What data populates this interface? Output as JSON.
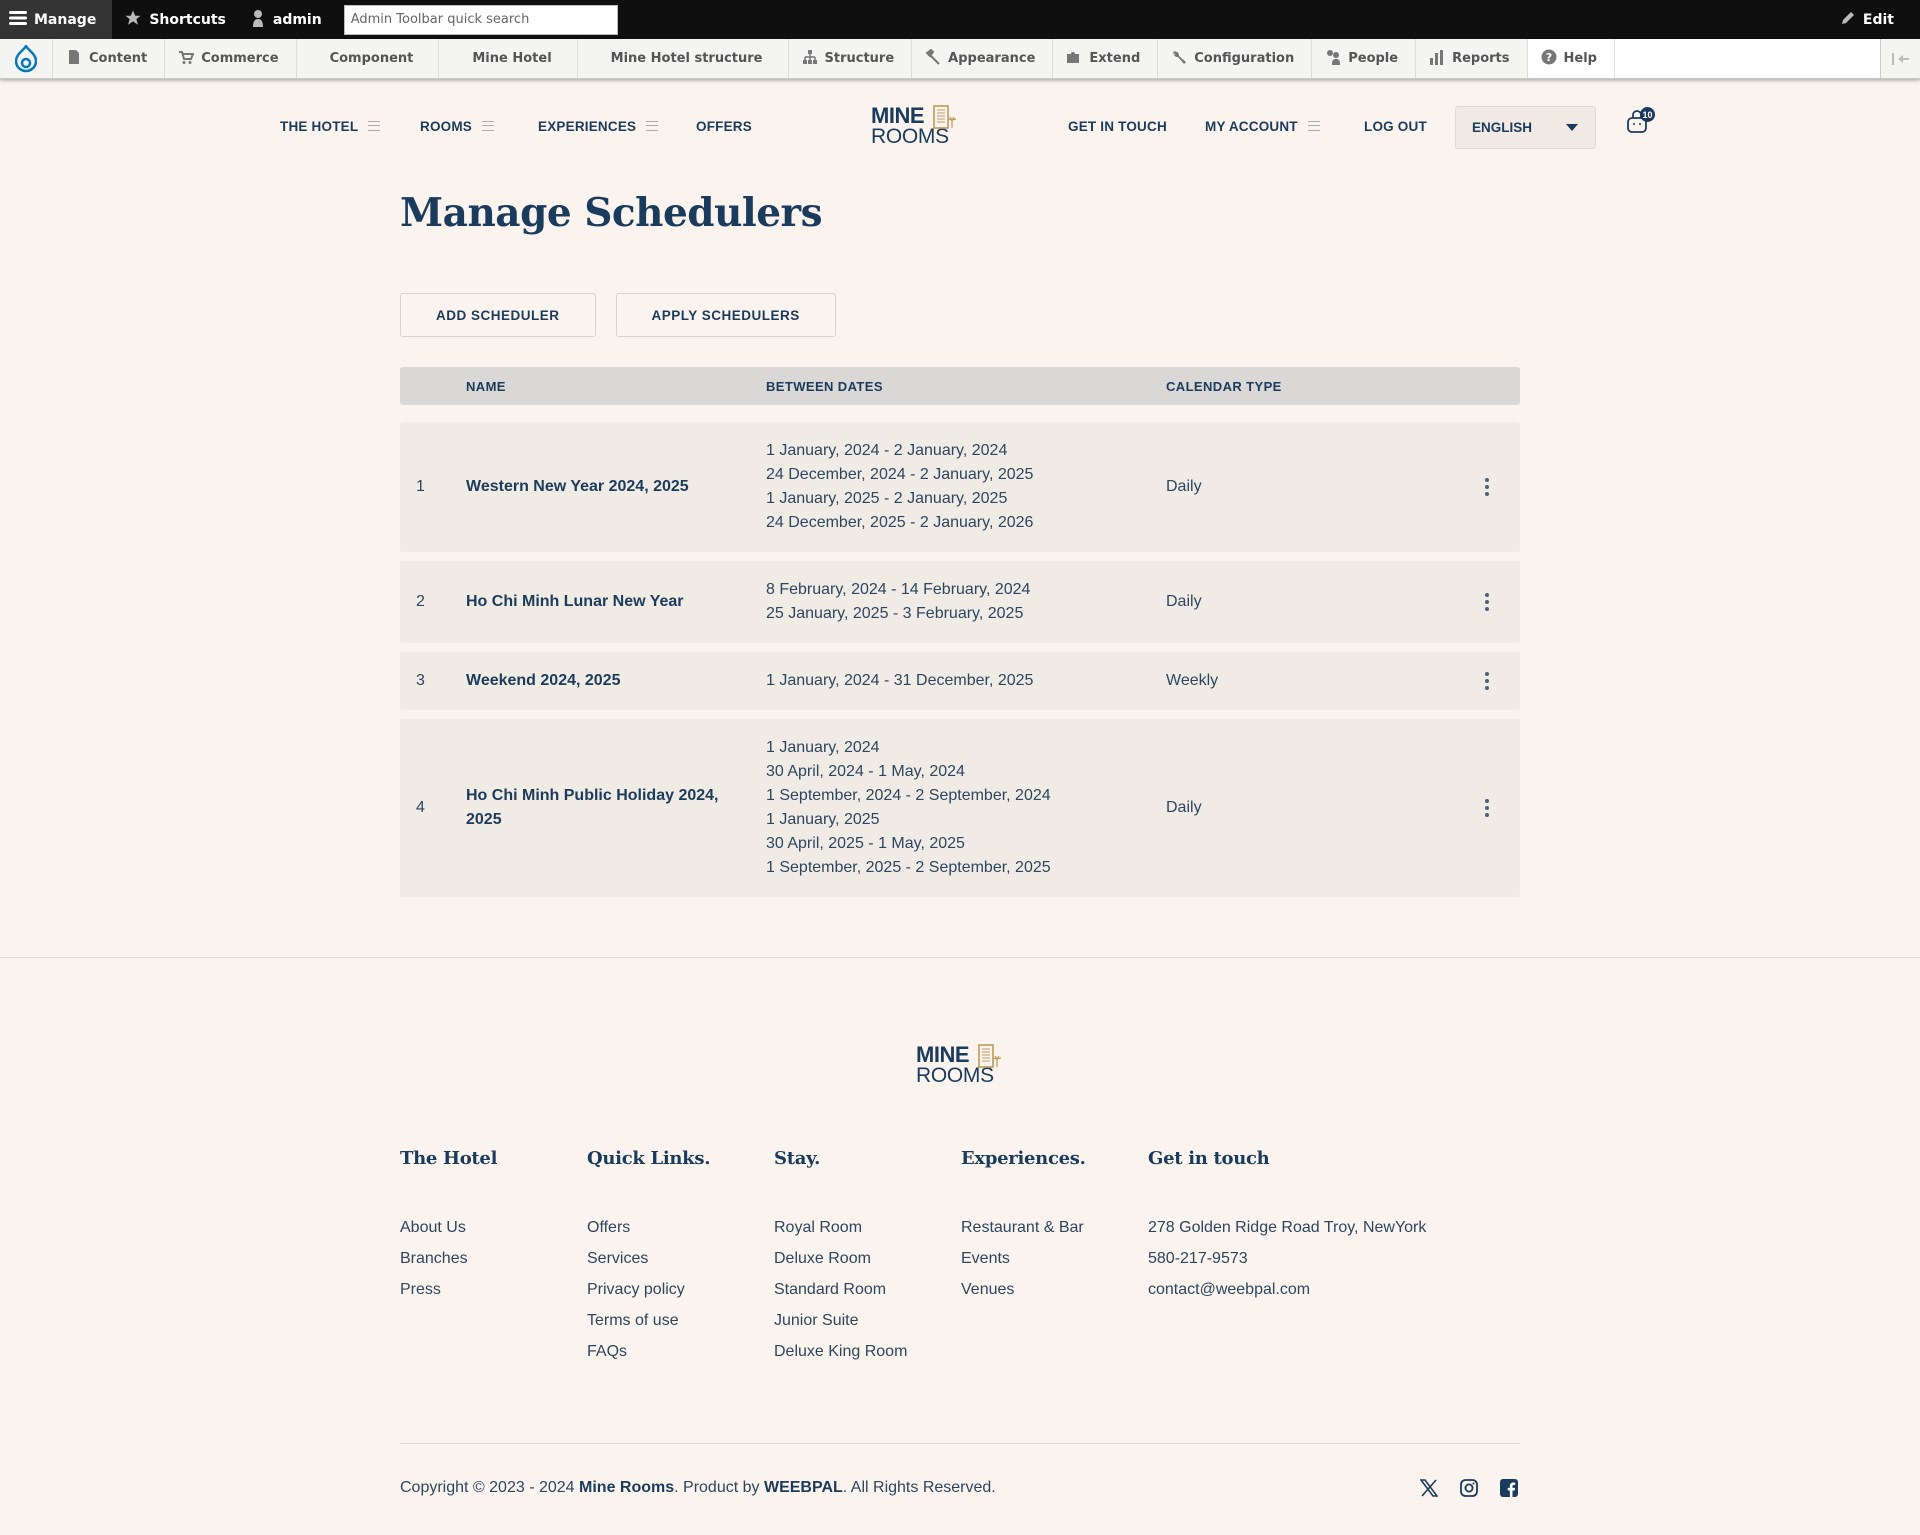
{
  "admin_toolbar": {
    "manage_label": "Manage",
    "shortcuts_label": "Shortcuts",
    "user_label": "admin",
    "search_placeholder": "Admin Toolbar quick search",
    "edit_label": "Edit",
    "menu": [
      {
        "label": "Content",
        "icon": "file-icon"
      },
      {
        "label": "Commerce",
        "icon": "cart-icon"
      },
      {
        "label": "Component",
        "icon": ""
      },
      {
        "label": "Mine Hotel",
        "icon": ""
      },
      {
        "label": "Mine Hotel structure",
        "icon": ""
      },
      {
        "label": "Structure",
        "icon": "sitemap-icon"
      },
      {
        "label": "Appearance",
        "icon": "paintbrush-icon"
      },
      {
        "label": "Extend",
        "icon": "puzzle-icon"
      },
      {
        "label": "Configuration",
        "icon": "wrench-icon"
      },
      {
        "label": "People",
        "icon": "people-icon"
      },
      {
        "label": "Reports",
        "icon": "bar-chart-icon"
      },
      {
        "label": "Help",
        "icon": "help-icon"
      }
    ]
  },
  "site_nav": {
    "left": [
      {
        "label": "THE HOTEL",
        "has_menu": true
      },
      {
        "label": "ROOMS",
        "has_menu": true
      },
      {
        "label": "EXPERIENCES",
        "has_menu": true
      },
      {
        "label": "OFFERS",
        "has_menu": false
      }
    ],
    "right": [
      {
        "label": "GET IN TOUCH",
        "has_menu": false
      },
      {
        "label": "MY ACCOUNT",
        "has_menu": true
      },
      {
        "label": "LOG OUT",
        "has_menu": false
      }
    ],
    "logo": {
      "line1": "MINE",
      "line2": "ROOMS"
    },
    "language": "ENGLISH",
    "cart_count": "10"
  },
  "page": {
    "title": "Manage Schedulers",
    "buttons": {
      "add": "ADD SCHEDULER",
      "apply": "APPLY SCHEDULERS"
    },
    "table": {
      "headers": {
        "num": "",
        "name": "NAME",
        "dates": "BETWEEN DATES",
        "type": "CALENDAR TYPE"
      },
      "rows": [
        {
          "num": "1",
          "name": "Western New Year 2024, 2025",
          "dates": [
            "1 January, 2024 - 2 January, 2024",
            "24 December, 2024 - 2 January, 2025",
            "1 January, 2025 - 2 January, 2025",
            "24 December, 2025 - 2 January, 2026"
          ],
          "type": "Daily"
        },
        {
          "num": "2",
          "name": "Ho Chi Minh Lunar New Year",
          "dates": [
            "8 February, 2024 - 14 February, 2024",
            "25 January, 2025 - 3 February, 2025"
          ],
          "type": "Daily"
        },
        {
          "num": "3",
          "name": "Weekend 2024, 2025",
          "dates": [
            "1 January, 2024 - 31 December, 2025"
          ],
          "type": "Weekly"
        },
        {
          "num": "4",
          "name": "Ho Chi Minh Public Holiday 2024, 2025",
          "dates": [
            "1 January, 2024",
            "30 April, 2024 - 1 May, 2024",
            "1 September, 2024 - 2 September, 2024",
            "1 January, 2025",
            "30 April, 2025 - 1 May, 2025",
            "1 September, 2025 - 2 September, 2025"
          ],
          "type": "Daily"
        }
      ]
    }
  },
  "footer": {
    "logo": {
      "line1": "MINE",
      "line2": "ROOMS"
    },
    "columns": [
      {
        "title": "The Hotel",
        "links": [
          "About Us",
          "Branches",
          "Press"
        ]
      },
      {
        "title": "Quick Links.",
        "links": [
          "Offers",
          "Services",
          "Privacy policy",
          "Terms of use",
          "FAQs"
        ]
      },
      {
        "title": "Stay.",
        "links": [
          "Royal Room",
          "Deluxe Room",
          "Standard Room",
          "Junior Suite",
          "Deluxe King Room"
        ]
      },
      {
        "title": "Experiences.",
        "links": [
          "Restaurant & Bar",
          "Events",
          "Venues"
        ]
      },
      {
        "title": "Get in touch",
        "links": [
          "278 Golden Ridge Road Troy, NewYork",
          "580-217-9573",
          "contact@weebpal.com"
        ]
      }
    ],
    "copyright": {
      "prefix": "Copyright © 2023 - 2024 ",
      "brand": "Mine Rooms",
      "middle": ". Product by ",
      "vendor": "WEEBPAL",
      "suffix": ". All Rights Reserved."
    },
    "socials": [
      "x-icon",
      "instagram-icon",
      "facebook-icon"
    ]
  },
  "colors": {
    "primary": "#1b3b5c",
    "background": "#fbf4ee",
    "row_bg": "#f1ebe5",
    "header_bg": "#d9d8d6",
    "accent_gold": "#b89b5e",
    "drupal_blue": "#0678be"
  }
}
